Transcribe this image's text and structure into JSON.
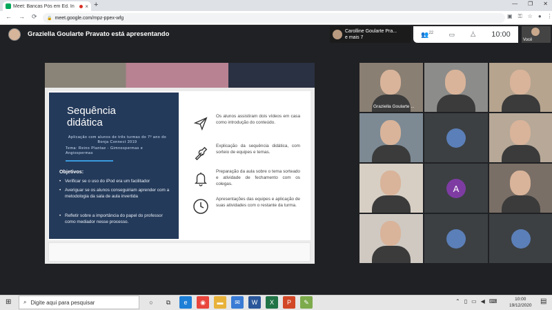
{
  "browser": {
    "tab_title": "Meet: Bancas Pós em Ed. In",
    "tab_close": "×",
    "new_tab": "+",
    "url": "meet.google.com/mpz-ppex-wfg",
    "window_controls": [
      "—",
      "❐",
      "✕"
    ]
  },
  "meet": {
    "presenting_text": "Graziella Goularte Pravato está apresentando",
    "participants_name": "Carolline Goularte Pra...",
    "participants_more": "e mais 7",
    "participant_count": "22",
    "time": "10:00",
    "self_label": "Você",
    "tiles": [
      {
        "name": "Graziella Goularte ...",
        "bg": "#8a7f73"
      },
      {
        "name": "",
        "bg": "#8c8c8a"
      },
      {
        "name": "",
        "bg": "#b6a48f"
      },
      {
        "name": "",
        "bg": "#7d8a94"
      },
      {
        "name": "",
        "bg": "#3c4043"
      },
      {
        "name": "",
        "bg": "#b7a898"
      },
      {
        "name": "",
        "bg": "#d7cfc4"
      },
      {
        "name": "",
        "bg": "#3c4043",
        "initial": "A"
      },
      {
        "name": "",
        "bg": "#7a6f66"
      },
      {
        "name": "",
        "bg": "#cfc9c2"
      },
      {
        "name": "",
        "bg": "#3c4043"
      },
      {
        "name": "",
        "bg": "#3c4043"
      }
    ]
  },
  "slide": {
    "title_line1": "Sequência",
    "title_line2": "didática",
    "subtitle": "Aplicação com alunos de três turmas do 7º ano do Bonja Connect 2019",
    "tema": "Tema: Reino Plantae - Gimnospermas e Angiospermas",
    "objectives_heading": "Objetivos:",
    "objectives": [
      "Verificar se o uso do iPod era um facilitador",
      "Averiguar se os alunos conseguiriam aprender com a metodologia da sala de aula invertida",
      "Refletir sobre a importância do papel do professor como mediador nesse processo."
    ],
    "steps": [
      {
        "icon": "paper-plane-icon",
        "text": "Os alunos assistiram dois vídeos em casa como introdução do conteúdo."
      },
      {
        "icon": "wrench-icon",
        "text": "Explicação da sequência didática, com sorteio de equipes e temas."
      },
      {
        "icon": "bell-icon",
        "text": "Preparação da aula sobre o tema sorteado e atividade de fechamento com os colegas."
      },
      {
        "icon": "clock-icon",
        "text": "Apresentações das equipes e aplicação de suas atividades com o restante da turma."
      }
    ]
  },
  "taskbar": {
    "search_placeholder": "Digite aqui para pesquisar",
    "clock_time": "10:00",
    "clock_date": "19/12/2020"
  },
  "colors": {
    "slide_blue": "#243a5a",
    "accent": "#3b9ce0",
    "meet_bg": "#202124"
  }
}
